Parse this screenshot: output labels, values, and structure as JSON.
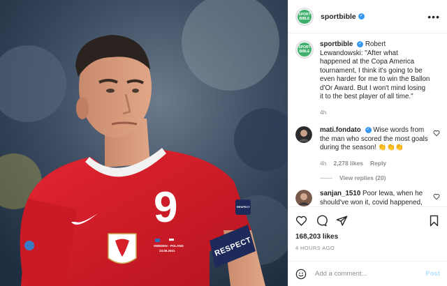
{
  "header": {
    "username": "sportbible",
    "avatar_text_top": "SPORT",
    "avatar_text_bottom": "BIBLE",
    "more": "•••"
  },
  "caption": {
    "username": "sportbible",
    "text": "Robert Lewandowski: \"After what happened at the Copa America tournament, I think it's going to be even harder for me to win the Ballon d'Or Award. But I won't mind losing it to the best player of all time.\"",
    "time": "4h"
  },
  "comments": [
    {
      "username": "mati.fondato",
      "text": "Wise words from the man who scored the most goals during the season! 👏👏👏",
      "time": "4h",
      "likes": "2,278 likes",
      "reply": "Reply",
      "view_replies": "View replies (20)"
    },
    {
      "username": "sanjan_1510",
      "text": "Poor lewa, when he should've won it, covid happened, now messi happened"
    }
  ],
  "actions": {
    "likes": "168,203 likes",
    "time_ago": "4 HOURS AGO"
  },
  "add_comment": {
    "placeholder": "Add a comment...",
    "post": "Post"
  },
  "photo": {
    "jersey_number": "9",
    "armband_text": "RESPECT",
    "sleeve_badge": "RESPECT",
    "match_text_1": "SWEDEN - POLAND",
    "match_text_2": "23.06.2021"
  },
  "colors": {
    "verified": "#3897f0",
    "post_disabled": "#b2dffc",
    "muted": "#8e8e8e",
    "jersey_red": "#d8202b",
    "brand_green": "#3fb06b"
  }
}
